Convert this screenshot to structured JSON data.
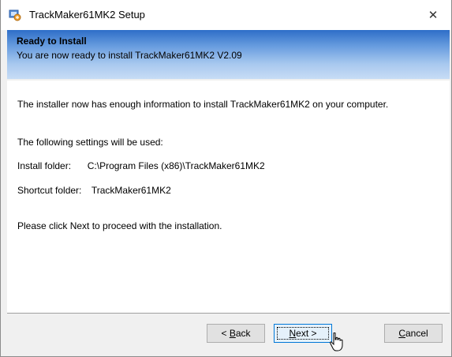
{
  "window": {
    "title": "TrackMaker61MK2 Setup",
    "close_glyph": "✕"
  },
  "header": {
    "title": "Ready to Install",
    "subtitle": "You are now ready to install TrackMaker61MK2 V2.09"
  },
  "content": {
    "intro": "The installer now has enough information to install TrackMaker61MK2 on your computer.",
    "settings_heading": "The following settings will be used:",
    "install_folder_label": "Install folder:",
    "install_folder_value": "C:\\Program Files (x86)\\TrackMaker61MK2",
    "shortcut_folder_label": "Shortcut folder:",
    "shortcut_folder_value": "TrackMaker61MK2",
    "instruction": "Please click Next to proceed with the installation."
  },
  "buttons": {
    "back_prefix": "< ",
    "back_mnemonic": "B",
    "back_rest": "ack",
    "next_mnemonic": "N",
    "next_rest": "ext >",
    "cancel_mnemonic": "C",
    "cancel_rest": "ancel"
  },
  "icons": {
    "app": "installer-icon",
    "close": "close-icon",
    "cursor": "mouse-pointer-icon"
  }
}
